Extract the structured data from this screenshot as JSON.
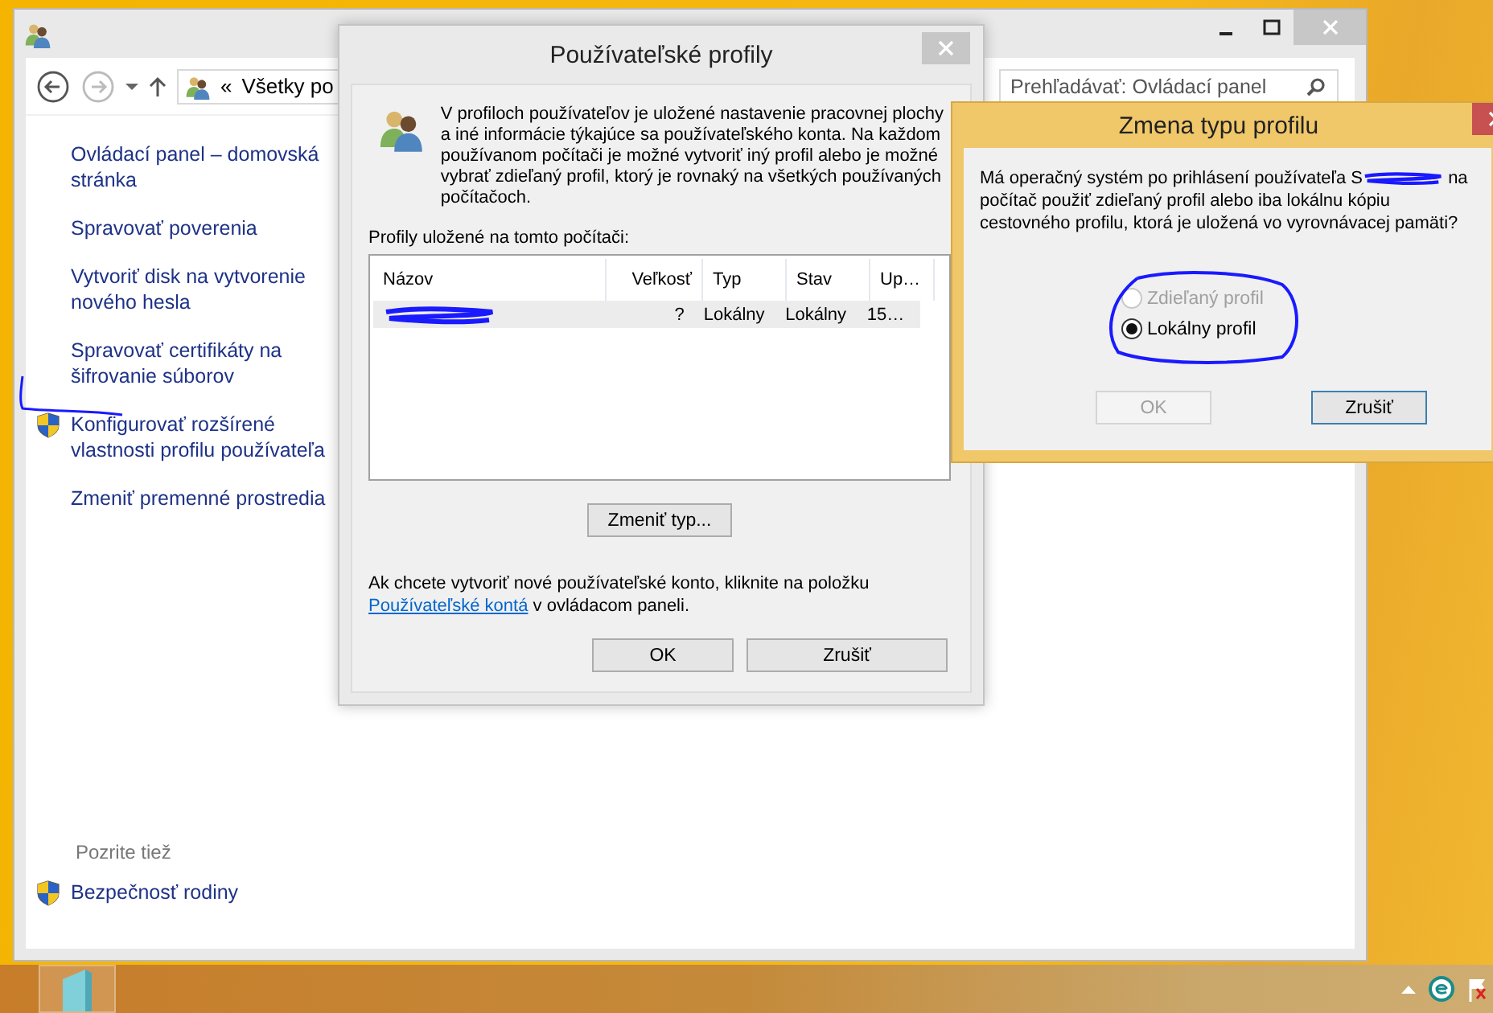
{
  "control_panel": {
    "address_prefix": "«",
    "address": "Všetky po",
    "search": {
      "placeholder": "Prehľadávať: Ovládací panel"
    },
    "links": [
      {
        "text": "Ovládací panel – domovská stránka",
        "shield": false
      },
      {
        "text": "Spravovať poverenia",
        "shield": false
      },
      {
        "text": "Vytvoriť disk na vytvorenie nového hesla",
        "shield": false
      },
      {
        "text": "Spravovať certifikáty na šifrovanie súborov",
        "shield": false
      },
      {
        "text": "Konfigurovať rozšírené vlastnosti profilu používateľa",
        "shield": true
      },
      {
        "text": "Zmeniť premenné prostredia",
        "shield": false
      }
    ],
    "see_also": {
      "heading": "Pozrite tiež",
      "links": [
        {
          "text": "Bezpečnosť rodiny",
          "shield": true
        }
      ]
    }
  },
  "profiles_dialog": {
    "title": "Používateľské profily",
    "description": "V profiloch používateľov je uložené nastavenie pracovnej plochy a iné informácie týkajúce sa používateľského konta. Na každom používanom počítači je možné vytvoriť iný profil alebo je možné vybrať zdieľaný profil, ktorý je rovnaký na všetkých používaných počítačoch.",
    "list_label": "Profily uložené na tomto počítači:",
    "columns": [
      "Názov",
      "Veľkosť",
      "Typ",
      "Stav",
      "Up…"
    ],
    "rows": [
      {
        "name_redacted": true,
        "cells": [
          "",
          "?",
          "Lokálny",
          "Lokálny",
          "15…"
        ],
        "selected": true
      }
    ],
    "change_type_button": "Zmeniť typ...",
    "note": "Ak chcete vytvoriť nové používateľské konto, kliknite na položku",
    "note_link": "Používateľské kontá",
    "note_end": "v ovládacom paneli.",
    "buttons": [
      "OK",
      "Zrušiť"
    ]
  },
  "change_type_dialog": {
    "title": "Zmena typu profilu",
    "question_start": "Má operačný systém po prihlásení používateľa S",
    "question_end": "na počítač použiť zdieľaný profil alebo iba lokálnu kópiu cestovného profilu, ktorá je uložená vo vyrovnávacej pamäti?",
    "options": [
      {
        "label": "Zdieľaný profil",
        "selected": false,
        "disabled": true
      },
      {
        "label": "Lokálny profil",
        "selected": true,
        "disabled": false
      }
    ],
    "buttons": [
      {
        "label": "OK",
        "disabled": true
      },
      {
        "label": "Zrušiť",
        "disabled": false
      }
    ]
  }
}
